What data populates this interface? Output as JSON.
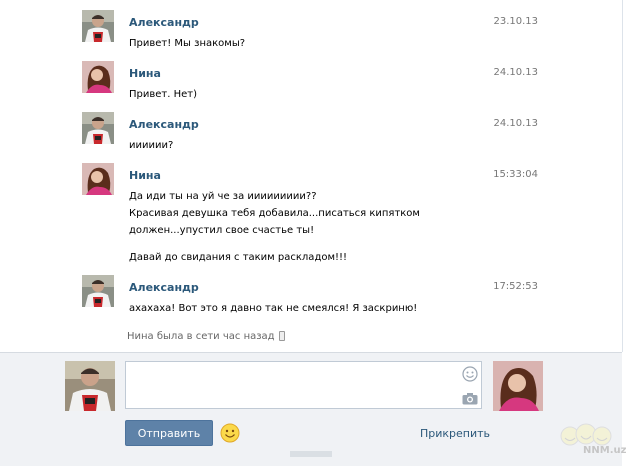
{
  "messages": [
    {
      "author": "Александр",
      "date": "23.10.13",
      "lines": [
        "Привет! Мы знакомы?"
      ],
      "avatar": "male-avatar"
    },
    {
      "author": "Нина",
      "date": "24.10.13",
      "lines": [
        "Привет. Нет)"
      ],
      "avatar": "female-avatar"
    },
    {
      "author": "Александр",
      "date": "24.10.13",
      "lines": [
        "ииииии?"
      ],
      "avatar": "male-avatar"
    },
    {
      "author": "Нина",
      "date": "15:33:04",
      "lines": [
        "Да иди ты на  уй че за иииииииии??",
        "Красивая девушка тебя добавила...писаться кипятком",
        "должен...упустил свое счастье ты!",
        "Давай до свидания с таким раскладом!!!"
      ],
      "avatar": "female-avatar"
    },
    {
      "author": "Александр",
      "date": "17:52:53",
      "lines": [
        "ахахаха! Вот это я давно так не смеялся! Я заскриню!"
      ],
      "avatar": "male-avatar"
    }
  ],
  "status": {
    "text": "Нина была в сети час назад",
    "icon": "mobile-phone-icon"
  },
  "compose": {
    "textarea_value": "",
    "send_label": "Отправить",
    "attach_label": "Прикрепить",
    "icons": [
      "smile-icon",
      "camera-icon",
      "emoji-icon"
    ]
  },
  "watermark": {
    "text": "NNM.uz"
  },
  "colors": {
    "accent": "#5e82a8",
    "author": "#2b587a",
    "compose_bg": "#f0f2f5"
  }
}
